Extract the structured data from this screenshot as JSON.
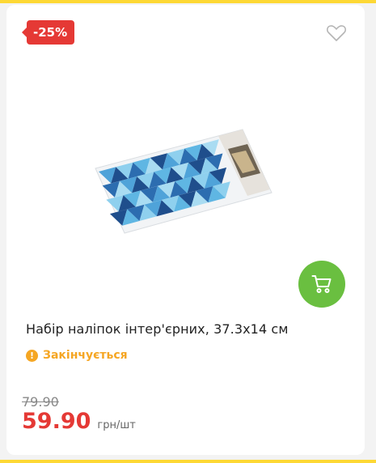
{
  "product": {
    "discount_badge": "-25%",
    "title": "Набір наліпок інтер'єрних, 37.3x14 см",
    "stock_status": "Закінчується",
    "old_price": "79.90",
    "new_price": "59.90",
    "price_unit": "грн/шт"
  },
  "icons": {
    "favorite": "heart-outline-icon",
    "cart": "shopping-cart-icon",
    "stock": "exclamation-circle-icon"
  },
  "colors": {
    "background_frame": "#fdd835",
    "badge": "#e53935",
    "price": "#e53935",
    "cart_button": "#6abf40",
    "stock_warning": "#f5a623"
  }
}
